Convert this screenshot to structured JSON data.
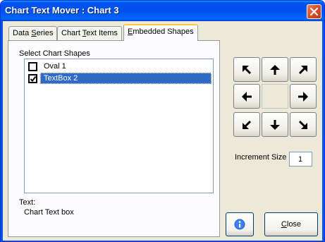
{
  "window": {
    "title": "Chart Text Mover : Chart 3"
  },
  "tabs": [
    {
      "label_pre": "Data ",
      "label_u": "S",
      "label_post": "eries",
      "active": false
    },
    {
      "label_pre": "Chart ",
      "label_u": "T",
      "label_post": "ext Items",
      "active": false
    },
    {
      "label_pre": "",
      "label_u": "E",
      "label_post": "mbedded Shapes",
      "active": true
    }
  ],
  "panel": {
    "group_label": "Select Chart Shapes",
    "items": [
      {
        "label": "Oval 1",
        "checked": false,
        "selected": false
      },
      {
        "label": "TextBox 2",
        "checked": true,
        "selected": true
      }
    ],
    "text_label": "Text:",
    "text_value": "Chart Text box"
  },
  "arrows": {
    "up_left": "arrow-up-left-icon",
    "up": "arrow-up-icon",
    "up_right": "arrow-up-right-icon",
    "left": "arrow-left-icon",
    "right": "arrow-right-icon",
    "down_left": "arrow-down-left-icon",
    "down": "arrow-down-icon",
    "down_right": "arrow-down-right-icon"
  },
  "increment": {
    "label": "Increment Size",
    "value": "1"
  },
  "buttons": {
    "info_icon": "info-icon",
    "close_pre": "",
    "close_u": "C",
    "close_post": "lose"
  }
}
